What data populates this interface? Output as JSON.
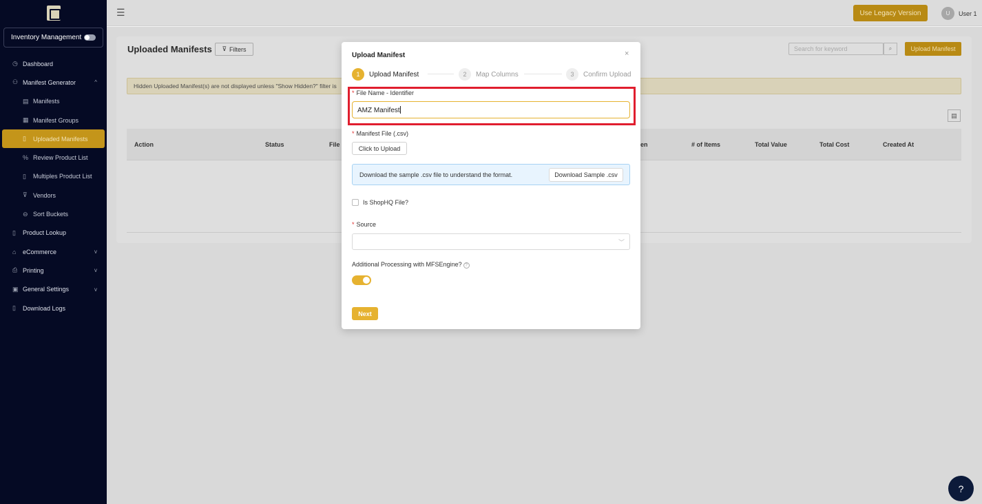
{
  "sidebar": {
    "module_label": "Inventory Management",
    "items": [
      {
        "label": "Dashboard",
        "icon": "dashboard-icon",
        "glyph": "◷"
      },
      {
        "label": "Manifest Generator",
        "icon": "hierarchy-icon",
        "glyph": "⚇",
        "chevron": "^"
      },
      {
        "label": "Manifests",
        "icon": "manifest-icon",
        "glyph": "▤"
      },
      {
        "label": "Manifest Groups",
        "icon": "group-icon",
        "glyph": "▦"
      },
      {
        "label": "Uploaded Manifests",
        "icon": "file-icon",
        "glyph": "▯"
      },
      {
        "label": "Review Product List",
        "icon": "percent-icon",
        "glyph": "%"
      },
      {
        "label": "Multiples Product List",
        "icon": "file-icon",
        "glyph": "▯"
      },
      {
        "label": "Vendors",
        "icon": "cart-icon",
        "glyph": "⊽"
      },
      {
        "label": "Sort Buckets",
        "icon": "bucket-icon",
        "glyph": "⊖"
      },
      {
        "label": "Product Lookup",
        "icon": "file-icon",
        "glyph": "▯"
      },
      {
        "label": "eCommerce",
        "icon": "shop-icon",
        "glyph": "⌂",
        "chevron": "v"
      },
      {
        "label": "Printing",
        "icon": "printer-icon",
        "glyph": "⎙",
        "chevron": "v"
      },
      {
        "label": "General Settings",
        "icon": "settings-icon",
        "glyph": "▣",
        "chevron": "v"
      },
      {
        "label": "Download Logs",
        "icon": "file-icon",
        "glyph": "▯"
      }
    ]
  },
  "topbar": {
    "legacy_label": "Use Legacy Version",
    "user_initial": "U",
    "user_name": "User 1"
  },
  "main": {
    "title": "Uploaded Manifests",
    "filters_label": "Filters",
    "search_placeholder": "Search for keyword",
    "upload_label": "Upload Manifest",
    "hidden_note": "Hidden Uploaded Manifest(s) are not displayed unless \"Show Hidden?\" filter is",
    "columns": [
      "Action",
      "Status",
      "File",
      "en",
      "# of Items",
      "Total Value",
      "Total Cost",
      "Created At"
    ]
  },
  "modal": {
    "title": "Upload Manifest",
    "close": "×",
    "steps": [
      {
        "num": "1",
        "label": "Upload Manifest"
      },
      {
        "num": "2",
        "label": "Map Columns"
      },
      {
        "num": "3",
        "label": "Confirm Upload"
      }
    ],
    "file_name_label": "File Name - Identifier",
    "file_name_value": "AMZ Manifest",
    "manifest_file_label": "Manifest File (.csv)",
    "click_upload_label": "Click to Upload",
    "info_text": "Download the sample .csv file to understand the format.",
    "download_sample_label": "Download Sample .csv",
    "shophq_label": "Is ShopHQ File?",
    "source_label": "Source",
    "source_value": "",
    "processing_label": "Additional Processing with MFSEngine?",
    "processing_enabled": true,
    "next_label": "Next"
  },
  "colors": {
    "accent": "#e6b230",
    "sidebar_bg": "#050a24",
    "highlight": "#e01e2e"
  }
}
